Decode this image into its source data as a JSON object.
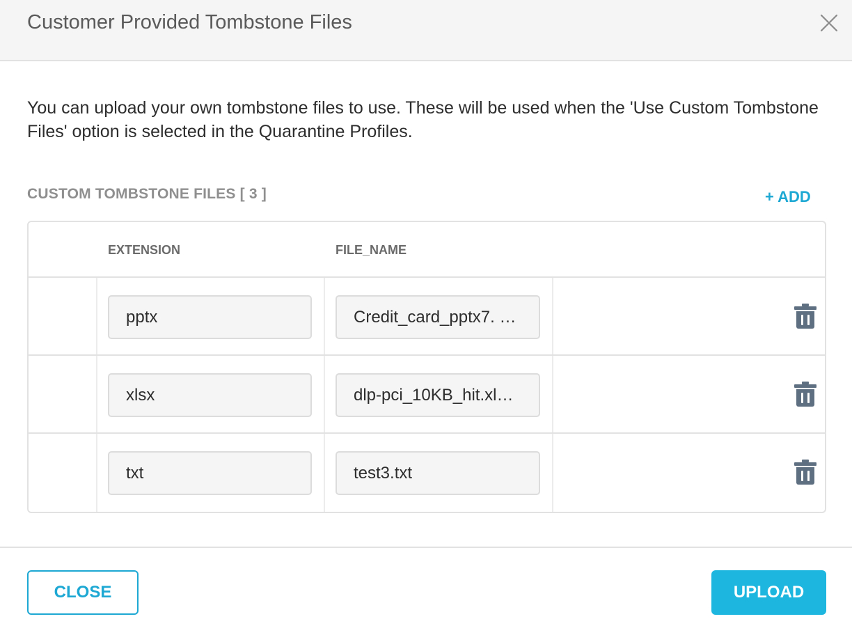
{
  "dialog": {
    "title": "Customer Provided Tombstone Files",
    "description": "You can upload your own tombstone files to use. These will be used when the 'Use Custom Tombstone Files' option is selected in the Quarantine Profiles."
  },
  "section": {
    "label": "CUSTOM TOMBSTONE FILES [ 3 ]",
    "add_label": "+ ADD"
  },
  "table": {
    "headers": [
      "EXTENSION",
      "FILE_NAME"
    ],
    "rows": [
      {
        "extension": "pptx",
        "file_name": "Credit_card_pptx7. …"
      },
      {
        "extension": "xlsx",
        "file_name": "dlp-pci_10KB_hit.xl…"
      },
      {
        "extension": "txt",
        "file_name": "test3.txt"
      }
    ]
  },
  "footer": {
    "close_label": "CLOSE",
    "upload_label": "UPLOAD"
  },
  "colors": {
    "accent": "#1da8d4",
    "upload_bg": "#1db6df",
    "trash_icon": "#5f6f82"
  },
  "icons": {
    "close": "close-x-icon",
    "delete": "trash-icon"
  }
}
